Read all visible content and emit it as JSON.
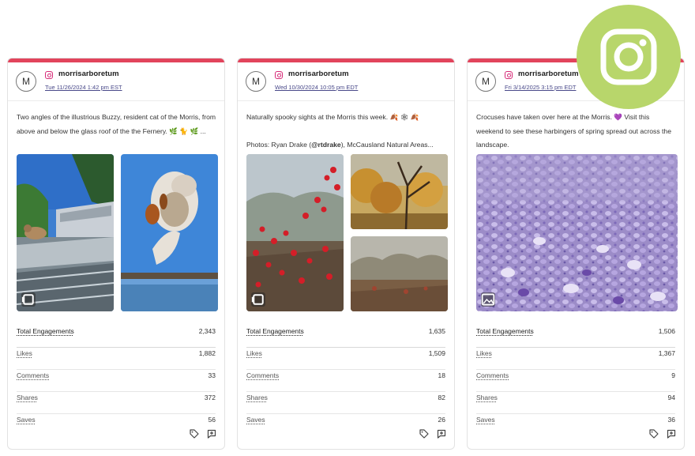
{
  "brand": {
    "accent": "#e2445c",
    "instagram_badge_bg": "#b8d66b",
    "instagram_color": "#d62976"
  },
  "posts": [
    {
      "avatar_letter": "M",
      "handle": "morrisarboretum",
      "date": "Tue 11/26/2024 1:42 pm EST",
      "text": "Two angles of the illustrious Buzzy, resident cat of the Morris, from above and below the glass roof of the the Fernery. 🌿 🐈 🌿 ...",
      "media_icon": "carousel-icon",
      "metrics": [
        {
          "label": "Total Engagements",
          "value": "2,343"
        },
        {
          "label": "Likes",
          "value": "1,882"
        },
        {
          "label": "Comments",
          "value": "33"
        },
        {
          "label": "Shares",
          "value": "372"
        },
        {
          "label": "Saves",
          "value": "56"
        }
      ]
    },
    {
      "avatar_letter": "M",
      "handle": "morrisarboretum",
      "date": "Wed 10/30/2024 10:05 pm EDT",
      "text_line1": "Naturally spooky sights at the Morris this week. 🍂 🕸 🍂",
      "text_line2_prefix": "Photos: Ryan Drake (",
      "text_line2_bold": "@rtdrake",
      "text_line2_suffix": "), McCausland Natural Areas...",
      "media_icon": "carousel-icon",
      "metrics": [
        {
          "label": "Total Engagements",
          "value": "1,635"
        },
        {
          "label": "Likes",
          "value": "1,509"
        },
        {
          "label": "Comments",
          "value": "18"
        },
        {
          "label": "Shares",
          "value": "82"
        },
        {
          "label": "Saves",
          "value": "26"
        }
      ]
    },
    {
      "avatar_letter": "M",
      "handle": "morrisarboretum",
      "date": "Fri 3/14/2025 3:15 pm EDT",
      "text": "Crocuses have taken over here at the Morris. 💜 Visit this weekend to see these harbingers of spring spread out across the landscape.",
      "media_icon": "image-icon",
      "metrics": [
        {
          "label": "Total Engagements",
          "value": "1,506"
        },
        {
          "label": "Likes",
          "value": "1,367"
        },
        {
          "label": "Comments",
          "value": "9"
        },
        {
          "label": "Shares",
          "value": "94"
        },
        {
          "label": "Saves",
          "value": "36"
        }
      ]
    }
  ]
}
